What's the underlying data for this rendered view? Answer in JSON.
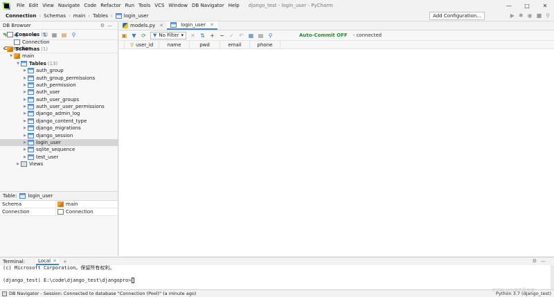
{
  "menubar": {
    "items": [
      "File",
      "Edit",
      "View",
      "Navigate",
      "Code",
      "Refactor",
      "Run",
      "Tools",
      "VCS",
      "Window",
      "DB Navigator",
      "Help"
    ],
    "window_title": "django_test - login_user - PyCharm"
  },
  "navbar": {
    "crumbs": [
      "Connection",
      "Schemas",
      "main",
      "Tables",
      "login_user"
    ],
    "add_config_label": "Add Configuration..."
  },
  "db_browser": {
    "title": "DB Browser",
    "connection_header": "Connection",
    "tree": [
      {
        "label": "Consoles",
        "count": "(1)",
        "depth": 1,
        "icon": "console"
      },
      {
        "label": "Connection",
        "count": "",
        "depth": 2,
        "icon": "console"
      },
      {
        "label": "Schemas",
        "count": "(1)",
        "depth": 1,
        "icon": "schema"
      },
      {
        "label": "main",
        "count": "",
        "depth": 2,
        "icon": "schema"
      },
      {
        "label": "Tables",
        "count": "(13)",
        "depth": 3,
        "icon": "table"
      },
      {
        "label": "auth_group",
        "count": "",
        "depth": 4,
        "icon": "table"
      },
      {
        "label": "auth_group_permissions",
        "count": "",
        "depth": 4,
        "icon": "table"
      },
      {
        "label": "auth_permission",
        "count": "",
        "depth": 4,
        "icon": "table"
      },
      {
        "label": "auth_user",
        "count": "",
        "depth": 4,
        "icon": "table"
      },
      {
        "label": "auth_user_groups",
        "count": "",
        "depth": 4,
        "icon": "table"
      },
      {
        "label": "auth_user_user_permissions",
        "count": "",
        "depth": 4,
        "icon": "table"
      },
      {
        "label": "django_admin_log",
        "count": "",
        "depth": 4,
        "icon": "table"
      },
      {
        "label": "django_content_type",
        "count": "",
        "depth": 4,
        "icon": "table"
      },
      {
        "label": "django_migrations",
        "count": "",
        "depth": 4,
        "icon": "table"
      },
      {
        "label": "django_session",
        "count": "",
        "depth": 4,
        "icon": "table"
      },
      {
        "label": "login_user",
        "count": "",
        "depth": 4,
        "icon": "table",
        "selected": true
      },
      {
        "label": "sqlite_sequence",
        "count": "",
        "depth": 4,
        "icon": "table"
      },
      {
        "label": "test_user",
        "count": "",
        "depth": 4,
        "icon": "table"
      },
      {
        "label": "Views",
        "count": "",
        "depth": 3,
        "icon": "views"
      }
    ]
  },
  "properties": {
    "header_label": "Table:",
    "header_value": "login_user",
    "rows": [
      {
        "key": "Schema",
        "value": "main",
        "icon": "schema"
      },
      {
        "key": "Connection",
        "value": "Connection",
        "icon": "console"
      }
    ]
  },
  "editor": {
    "tabs": [
      {
        "label": "models.py",
        "active": false
      },
      {
        "label": "login_user",
        "active": true
      }
    ],
    "filter_label": "No Filter",
    "autocommit_label": "Auto-Commit OFF",
    "connection_status": "- connected",
    "columns": [
      "user_id",
      "name",
      "pwd",
      "email",
      "phone"
    ]
  },
  "terminal": {
    "title": "Terminal:",
    "tab_label": "Local",
    "lines": [
      "(c) Microsoft Corporation。保留所有权利。",
      "",
      "(django_test) E:\\code\\django_test\\djangopro>"
    ]
  },
  "statusbar": {
    "message": "DB Navigator - Session: Connected to database \"Connection (Pool)\" (a minute ago)",
    "right": "Python 3.7 (django_test)"
  },
  "watermark": "CSDN @小金不是大金"
}
